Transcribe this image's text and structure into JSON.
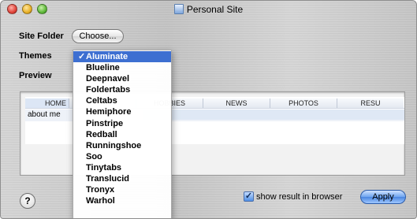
{
  "window": {
    "title": "Personal Site"
  },
  "form": {
    "site_folder_label": "Site Folder",
    "choose_label": "Choose...",
    "themes_label": "Themes",
    "preview_label": "Preview"
  },
  "themes": {
    "selected_check": "✓",
    "options": [
      "Aluminate",
      "Blueline",
      "Deepnavel",
      "Foldertabs",
      "Celtabs",
      "Hemiphore",
      "Pinstripe",
      "Redball",
      "Runningshoe",
      "Soo",
      "Tinytabs",
      "Translucid",
      "Tronyx",
      "Warhol"
    ]
  },
  "preview": {
    "tabs": [
      "HOME",
      "",
      "HOBBIES",
      "NEWS",
      "PHOTOS",
      "RESU"
    ],
    "row_text": "about me"
  },
  "footer": {
    "help_label": "?",
    "checkbox_mark": "✓",
    "show_result_label": "show result in browser",
    "apply_label": "Apply"
  }
}
